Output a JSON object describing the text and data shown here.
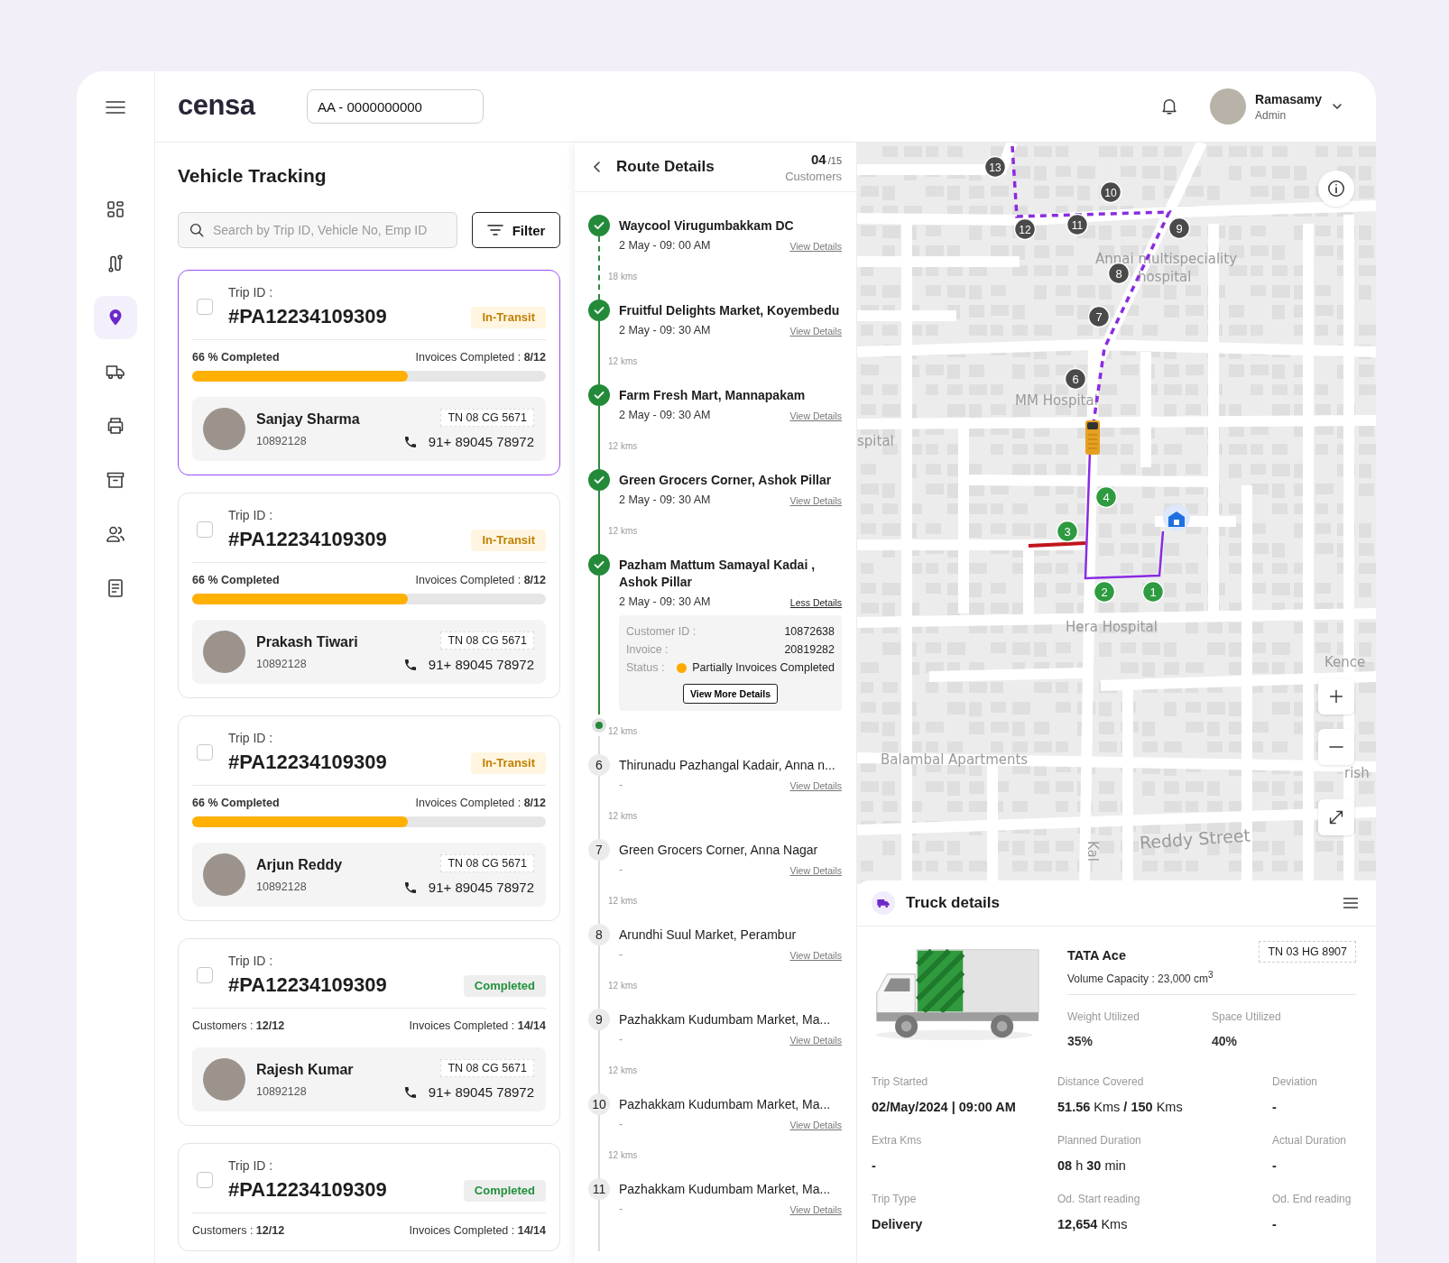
{
  "sidebar": {
    "items": [
      {
        "selected": false
      },
      {
        "selected": false
      },
      {
        "selected": true
      },
      {
        "selected": false
      },
      {
        "selected": false
      },
      {
        "selected": false
      },
      {
        "selected": false
      },
      {
        "selected": false
      }
    ]
  },
  "header": {
    "logo": "censa",
    "account_field": {
      "value": "AA - 0000000000"
    },
    "user": {
      "name": "Ramasamy",
      "role": "Admin"
    }
  },
  "vehicle_tracking": {
    "title": "Vehicle Tracking",
    "search": {
      "placeholder": "Search by Trip ID, Vehicle No, Emp ID"
    },
    "filter_button": "Filter",
    "trips": [
      {
        "selected": true,
        "checked": false,
        "trip_label": "Trip ID :",
        "trip_id": "#PA12234109309",
        "status": {
          "kind": "in_transit",
          "label": "In-Transit"
        },
        "progress": {
          "label": "66 % Completed",
          "level": 0.61
        },
        "invoices": "Invoices Completed  : **8/12**",
        "driver": {
          "name": "Sanjay Sharma",
          "id": "10892128",
          "plate": "TN 08 CG 5671",
          "phone": "91+ 89045 78972"
        }
      },
      {
        "selected": false,
        "checked": false,
        "trip_label": "Trip ID :",
        "trip_id": "#PA12234109309",
        "status": {
          "kind": "in_transit",
          "label": "In-Transit"
        },
        "progress": {
          "label": "66 % Completed",
          "level": 0.61
        },
        "invoices": "Invoices Completed  : **8/12**",
        "driver": {
          "name": "Prakash Tiwari",
          "id": "10892128",
          "plate": "TN 08 CG 5671",
          "phone": "91+ 89045 78972"
        }
      },
      {
        "selected": false,
        "checked": false,
        "trip_label": "Trip ID :",
        "trip_id": "#PA12234109309",
        "status": {
          "kind": "in_transit",
          "label": "In-Transit"
        },
        "progress": {
          "label": "66 % Completed",
          "level": 0.61
        },
        "invoices": "Invoices Completed  : **8/12**",
        "driver": {
          "name": "Arjun Reddy",
          "id": "10892128",
          "plate": "TN 08 CG 5671",
          "phone": "91+ 89045 78972"
        }
      },
      {
        "selected": false,
        "checked": false,
        "trip_label": "Trip ID :",
        "trip_id": "#PA12234109309",
        "status": {
          "kind": "completed",
          "label": "Completed"
        },
        "customers": "Customers  : **12/12**",
        "invoices": "Invoices Completed  : **14/14**",
        "driver": {
          "name": "Rajesh Kumar",
          "id": "10892128",
          "plate": "TN 08 CG 5671",
          "phone": "91+ 89045 78972"
        }
      },
      {
        "selected": false,
        "checked": false,
        "trip_label": "Trip ID :",
        "trip_id": "#PA12234109309",
        "status": {
          "kind": "completed",
          "label": "Completed"
        },
        "customers": "Customers  : **12/12**",
        "invoices": "Invoices Completed  : **14/14**"
      }
    ]
  },
  "route_details": {
    "title": "Route Details",
    "count": "04",
    "total": "/15",
    "count_label": "Customers",
    "items": [
      {
        "kind": "stop",
        "done": true,
        "name": "Waycool Virugumbakkam DC",
        "time": "2 May - 09: 00 AM",
        "link": "View Details",
        "distance": "18 kms",
        "dashed": true
      },
      {
        "kind": "stop",
        "done": true,
        "name": "Fruitful Delights Market, Koyembedu",
        "time": "2 May - 09: 30 AM",
        "link": "View Details",
        "distance": "12 kms",
        "dashed": false
      },
      {
        "kind": "stop",
        "done": true,
        "name": "Farm Fresh Mart, Mannapakam",
        "time": "2 May - 09: 30 AM",
        "link": "View Details",
        "distance": "12 kms",
        "dashed": false
      },
      {
        "kind": "stop",
        "done": true,
        "name": "Green Grocers Corner, Ashok Pillar",
        "time": "2 May - 09: 30 AM",
        "link": "View Details",
        "distance": "12 kms",
        "dashed": false
      },
      {
        "kind": "stop",
        "done": true,
        "name": "Pazham Mattum Samayal Kadai , Ashok Pillar",
        "time": "2 May - 09: 30 AM",
        "link": "Less Details",
        "dashed": false,
        "details": {
          "rows": [
            {
              "label": "Customer ID :",
              "value": "10872638"
            },
            {
              "label": "Invoice :",
              "value": "20819282"
            },
            {
              "label": "Status :",
              "value": "Partially Invoices Completed",
              "color": "#ffaa00"
            }
          ],
          "button": "View More Details"
        }
      },
      {
        "kind": "position",
        "distance": "12 kms"
      },
      {
        "kind": "stop",
        "done": false,
        "number": "6",
        "name": "Thirunadu Pazhangal Kadair, Anna n...",
        "time": "-",
        "link": "View Details",
        "distance": "12 kms",
        "dashed": false
      },
      {
        "kind": "stop",
        "done": false,
        "number": "7",
        "name": "Green Grocers Corner, Anna Nagar",
        "time": "-",
        "link": "View Details",
        "distance": "12 kms",
        "dashed": false
      },
      {
        "kind": "stop",
        "done": false,
        "number": "8",
        "name": "Arundhi Suul Market, Perambur",
        "time": "-",
        "link": "View Details",
        "distance": "12 kms",
        "dashed": false
      },
      {
        "kind": "stop",
        "done": false,
        "number": "9",
        "name": "Pazhakkam Kudumbam Market, Ma...",
        "time": "-",
        "link": "View Details",
        "distance": "12 kms",
        "dashed": false
      },
      {
        "kind": "stop",
        "done": false,
        "number": "10",
        "name": "Pazhakkam Kudumbam Market, Ma...",
        "time": "-",
        "link": "View Details",
        "distance": "12 kms",
        "dashed": false
      },
      {
        "kind": "stop",
        "done": false,
        "number": "11",
        "name": "Pazhakkam Kudumbam Market, Ma...",
        "time": "-",
        "link": "View Details",
        "dashed": false
      }
    ]
  },
  "map": {
    "labels": [
      "Annai multispeciality",
      "hospital",
      "MM Hospital",
      "spital",
      "Hera Hospital",
      "Kence",
      "Balambal Apartments",
      "rish",
      "Reddy Street",
      "Kal"
    ],
    "markers": [
      {
        "number": "13",
        "done": false
      },
      {
        "number": "10",
        "done": false
      },
      {
        "number": "12",
        "done": false
      },
      {
        "number": "11",
        "done": false
      },
      {
        "number": "9",
        "done": false
      },
      {
        "number": "8",
        "done": false
      },
      {
        "number": "7",
        "done": false
      },
      {
        "number": "6",
        "done": false
      },
      {
        "number": "4",
        "done": true
      },
      {
        "number": "3",
        "done": true
      },
      {
        "number": "2",
        "done": true
      },
      {
        "number": "1",
        "done": true
      }
    ]
  },
  "truck_details": {
    "title": "Truck details",
    "model": "TATA Ace",
    "capacity": "Volume Capacity : 23,000 cm$^{3}$",
    "plate": "TN 03 HG 8907",
    "utilization": [
      {
        "label": "Weight Utilized",
        "value": "35%"
      },
      {
        "label": "Space Utilized",
        "value": "40%"
      }
    ],
    "fields": [
      {
        "kind": "text",
        "label": "Trip Started",
        "value": "02/May/2024 | 09:00 AM"
      },
      {
        "kind": "measure",
        "label": "Distance Covered",
        "value": "**51.56** Kms **/ 150** Kms"
      },
      {
        "kind": "text",
        "label": "Deviation",
        "value": "-"
      },
      {
        "kind": "text",
        "label": "Extra Kms",
        "value": "-"
      },
      {
        "kind": "measure",
        "label": "Planned Duration",
        "value": "**08** h **30** min"
      },
      {
        "kind": "text",
        "label": "Actual Duration",
        "value": "-"
      },
      {
        "kind": "text",
        "label": "Trip Type",
        "value": "Delivery"
      },
      {
        "kind": "measure",
        "label": "Od. Start reading",
        "value": "**12,654** Kms"
      },
      {
        "kind": "text",
        "label": "Od. End reading",
        "value": "-"
      }
    ]
  }
}
